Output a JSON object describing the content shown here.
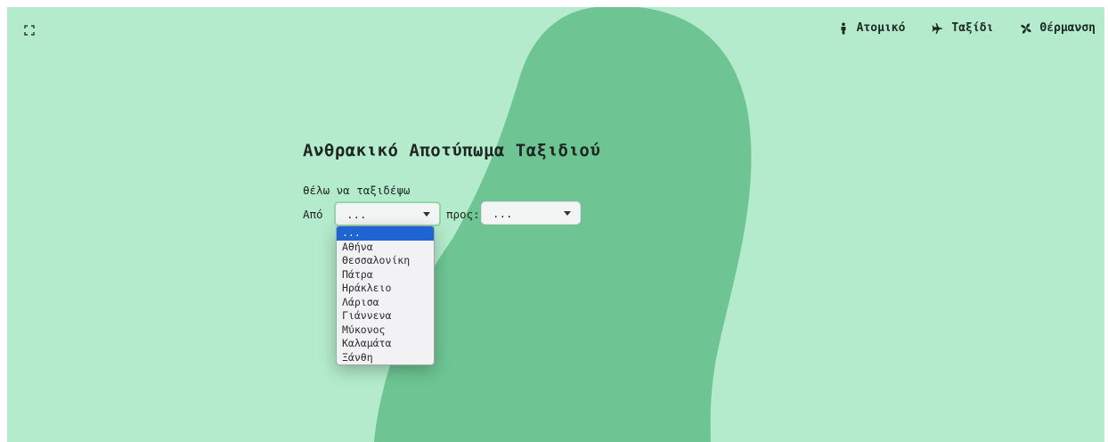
{
  "nav": {
    "items": [
      {
        "label": "Ατομικό",
        "icon": "person-icon"
      },
      {
        "label": "Ταξίδι",
        "icon": "plane-icon"
      },
      {
        "label": "Θέρμανση",
        "icon": "fan-icon"
      }
    ]
  },
  "page": {
    "title": "Ανθρακικό Αποτύπωμα Ταξιδιού",
    "subtitle": "θέλω να ταξιδέψω"
  },
  "form": {
    "from_label": "Από",
    "to_label": "προς:",
    "from_value": "...",
    "to_value": "...",
    "options": [
      "...",
      "Αθήνα",
      "Θεσσαλονίκη",
      "Πάτρα",
      "Ηράκλειο",
      "Λάρισα",
      "Γιάννενα",
      "Μύκονος",
      "Καλαμάτα",
      "Ξάνθη"
    ],
    "selected_option": "..."
  },
  "colors": {
    "background": "#b3ebcc",
    "blob": "#6ec593",
    "highlight": "#1f64d3"
  }
}
